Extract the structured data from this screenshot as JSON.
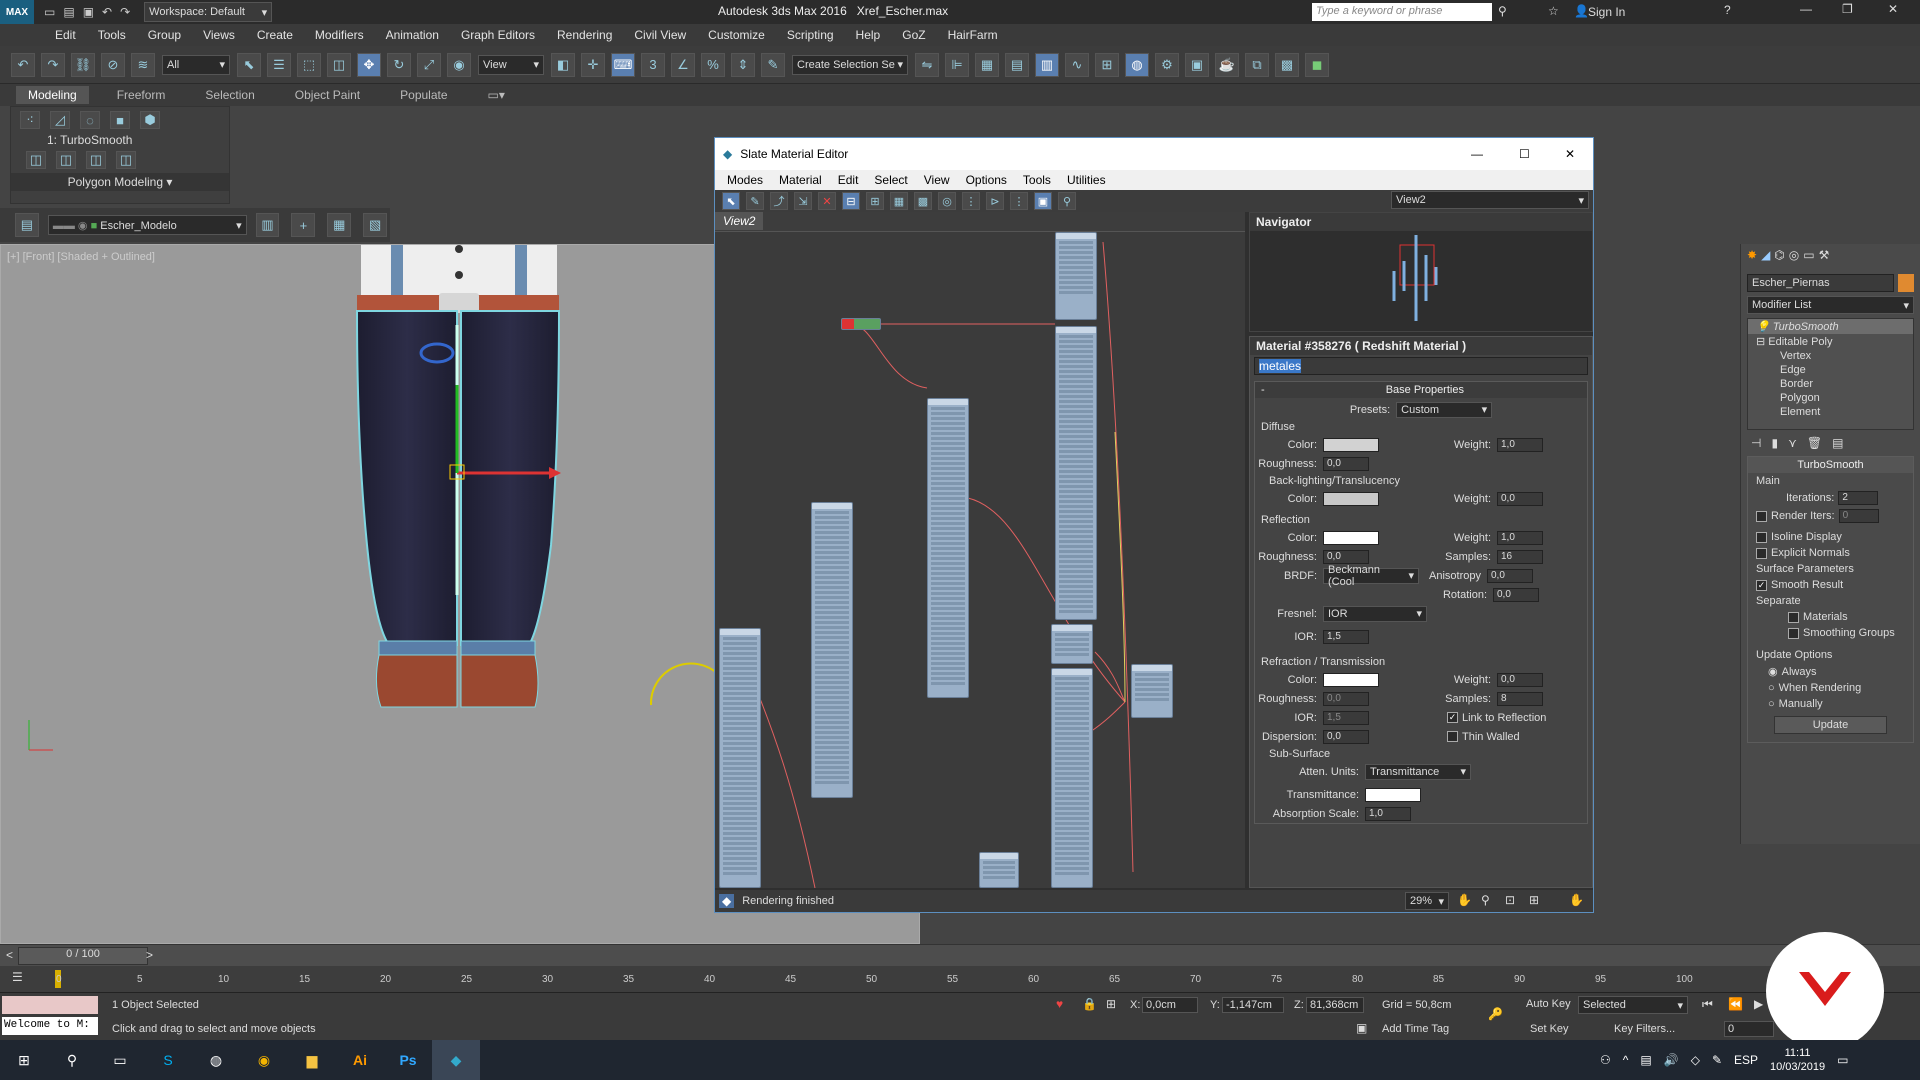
{
  "app": {
    "title": "Autodesk 3ds Max 2016",
    "file": "Xref_Escher.max",
    "workspace": "Workspace: Default",
    "search_placeholder": "Type a keyword or phrase",
    "sign_in": "Sign In"
  },
  "menu": [
    "Edit",
    "Tools",
    "Group",
    "Views",
    "Create",
    "Modifiers",
    "Animation",
    "Graph Editors",
    "Rendering",
    "Civil View",
    "Customize",
    "Scripting",
    "Help",
    "GoZ",
    "HairFarm"
  ],
  "toolbar": {
    "filter": "All",
    "ref_coord": "View",
    "selection_set": "Create Selection Se"
  },
  "ribbon": {
    "tabs": [
      "Modeling",
      "Freeform",
      "Selection",
      "Object Paint",
      "Populate"
    ],
    "active_tab": "Modeling",
    "modifier": "1: TurboSmooth",
    "group_label": "Polygon Modeling"
  },
  "scene": {
    "layer": "Escher_Modelo"
  },
  "viewport": {
    "label": "[+] [Front] [Shaded + Outlined]"
  },
  "slate": {
    "title": "Slate Material Editor",
    "menu": [
      "Modes",
      "Material",
      "Edit",
      "Select",
      "View",
      "Options",
      "Tools",
      "Utilities"
    ],
    "view_dropdown": "View2",
    "view_tab": "View2",
    "navigator": "Navigator",
    "status": "Rendering finished",
    "zoom": "29%",
    "material": {
      "header": "Material #358276  ( Redshift Material )",
      "name": "metales",
      "rollout": "Base Properties",
      "presets_label": "Presets:",
      "presets_value": "Custom",
      "diffuse": {
        "title": "Diffuse",
        "color_label": "Color:",
        "weight_label": "Weight:",
        "weight": "1,0",
        "roughness_label": "Roughness:",
        "roughness": "0,0"
      },
      "backlight": {
        "title": "Back-lighting/Translucency",
        "color_label": "Color:",
        "weight_label": "Weight:",
        "weight": "0,0"
      },
      "reflection": {
        "title": "Reflection",
        "color_label": "Color:",
        "weight_label": "Weight:",
        "weight": "1,0",
        "roughness_label": "Roughness:",
        "roughness": "0,0",
        "samples_label": "Samples:",
        "samples": "16",
        "brdf_label": "BRDF:",
        "brdf": "Beckmann (Cool",
        "anisotropy_label": "Anisotropy",
        "anisotropy": "0,0",
        "rotation_label": "Rotation:",
        "rotation": "0,0",
        "fresnel_label": "Fresnel:",
        "fresnel": "IOR",
        "ior_label": "IOR:",
        "ior": "1,5"
      },
      "refraction": {
        "title": "Refraction / Transmission",
        "color_label": "Color:",
        "weight_label": "Weight:",
        "weight": "0,0",
        "roughness_label": "Roughness:",
        "roughness": "0,0",
        "samples_label": "Samples:",
        "samples": "8",
        "ior_label": "IOR:",
        "ior": "1,5",
        "link_label": "Link to Reflection",
        "dispersion_label": "Dispersion:",
        "dispersion": "0,0",
        "thin_label": "Thin Walled"
      },
      "subsurface": {
        "title": "Sub-Surface",
        "units_label": "Atten. Units:",
        "units": "Transmittance",
        "transmittance_label": "Transmittance:",
        "absorption_label": "Absorption Scale:",
        "absorption": "1,0"
      }
    }
  },
  "command_panel": {
    "object_name": "Escher_Piernas",
    "modifier_list": "Modifier List",
    "stack": [
      "TurboSmooth",
      "Editable Poly",
      "Vertex",
      "Edge",
      "Border",
      "Polygon",
      "Element"
    ],
    "turbosmooth": {
      "title": "TurboSmooth",
      "main": "Main",
      "iterations_label": "Iterations:",
      "iterations": "2",
      "render_iters_label": "Render Iters:",
      "render_iters": "0",
      "isoline": "Isoline Display",
      "explicit": "Explicit Normals",
      "surface": "Surface Parameters",
      "smooth_result": "Smooth Result",
      "separate": "Separate",
      "materials": "Materials",
      "smoothing_groups": "Smoothing Groups",
      "update_options": "Update Options",
      "always": "Always",
      "when_rendering": "When Rendering",
      "manually": "Manually",
      "update_btn": "Update"
    }
  },
  "timeline": {
    "frame": "0 / 100",
    "ticks": [
      "0",
      "5",
      "10",
      "15",
      "20",
      "25",
      "30",
      "35",
      "40",
      "45",
      "50",
      "55",
      "60",
      "65",
      "70",
      "75",
      "80",
      "85",
      "90",
      "95",
      "100"
    ]
  },
  "status": {
    "maxscript": "Welcome to M:",
    "selected": "1 Object Selected",
    "prompt": "Click and drag to select and move objects",
    "x_label": "X:",
    "x": "0,0cm",
    "y_label": "Y:",
    "y": "-1,147cm",
    "z_label": "Z:",
    "z": "81,368cm",
    "grid": "Grid = 50,8cm",
    "add_time_tag": "Add Time Tag",
    "auto_key": "Auto Key",
    "set_key": "Set Key",
    "key_mode": "Selected",
    "key_filters": "Key Filters...",
    "frame_field": "0"
  },
  "taskbar": {
    "lang": "ESP",
    "time": "11:11",
    "date": "10/03/2019"
  },
  "colors": {
    "accent": "#5a7fb0",
    "pants": "#262640",
    "shoes": "#9a4830",
    "belt": "#b2543a",
    "logo_red": "#d91c1c"
  }
}
